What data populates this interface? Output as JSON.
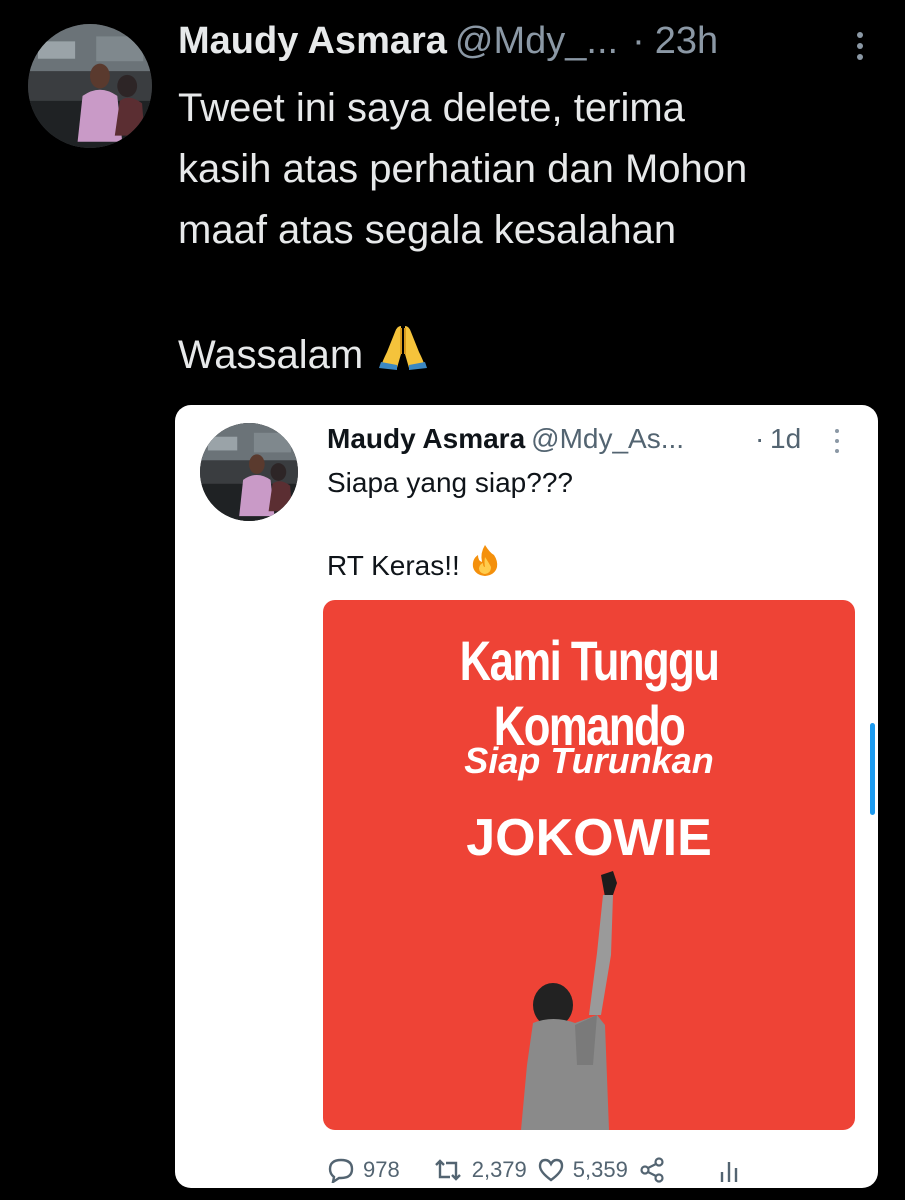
{
  "tweet": {
    "author_name": "Maudy Asmara",
    "handle": "@Mdy_...",
    "separator": "·",
    "time": "23h",
    "more_icon": "more-vertical-icon",
    "text_lines": [
      "Tweet ini saya delete, terima",
      "kasih atas perhatian dan Mohon",
      "maaf atas segala kesalahan"
    ],
    "signoff": "Wassalam",
    "signoff_emoji": "folded-hands-emoji"
  },
  "quoted": {
    "author_name": "Maudy Asmara",
    "handle": "@Mdy_As...",
    "separator": "·",
    "time": "1d",
    "line1": "Siapa yang siap???",
    "line2": "RT Keras!!",
    "line2_emoji": "fire-emoji",
    "poster": {
      "title": "Kami Tunggu Komando",
      "subtitle": "Siap Turunkan",
      "main": "JOKOWIE",
      "background": "#ee4336"
    },
    "actions": {
      "replies": "978",
      "retweets": "2,379",
      "likes": "5,359"
    }
  },
  "colors": {
    "background": "#000000",
    "text_primary": "#e7e9ea",
    "text_secondary": "#8b98a5",
    "accent": "#1d9bf0"
  }
}
